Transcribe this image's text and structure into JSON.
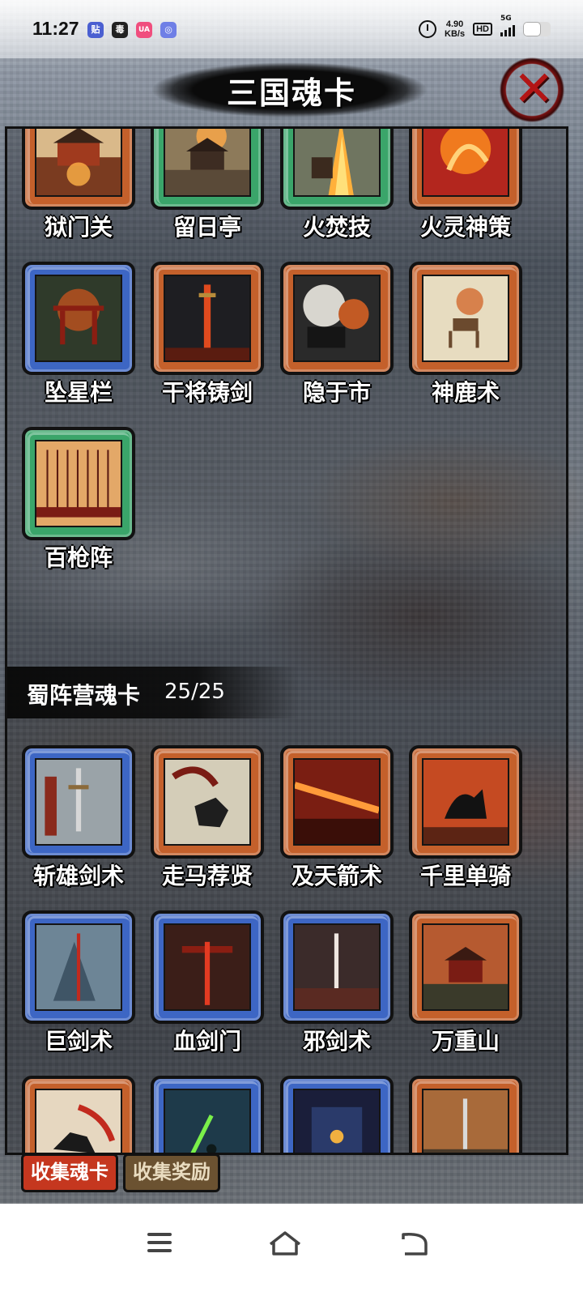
{
  "status_bar": {
    "time": "11:27",
    "app_icons": [
      "贴",
      "毒",
      "UA",
      "◎"
    ],
    "net_speed_value": "4.90",
    "net_speed_unit": "KB/s",
    "hd": "HD",
    "network": "5G",
    "battery_level": 0.65
  },
  "header": {
    "title": "三国魂卡",
    "close_icon": "close-icon"
  },
  "top_cards": [
    {
      "label": "狱门关",
      "rarity": "orange"
    },
    {
      "label": "留日亭",
      "rarity": "green"
    },
    {
      "label": "火焚技",
      "rarity": "green"
    },
    {
      "label": "火灵神策",
      "rarity": "orange"
    },
    {
      "label": "坠星栏",
      "rarity": "blue"
    },
    {
      "label": "干将铸剑",
      "rarity": "orange"
    },
    {
      "label": "隐于市",
      "rarity": "orange"
    },
    {
      "label": "神鹿术",
      "rarity": "orange"
    },
    {
      "label": "百枪阵",
      "rarity": "green"
    }
  ],
  "section": {
    "title": "蜀阵营魂卡",
    "count": "25/25"
  },
  "shu_cards": [
    {
      "label": "斩雄剑术",
      "rarity": "blue"
    },
    {
      "label": "走马荐贤",
      "rarity": "orange"
    },
    {
      "label": "及天箭术",
      "rarity": "orange"
    },
    {
      "label": "千里单骑",
      "rarity": "orange"
    },
    {
      "label": "巨剑术",
      "rarity": "blue"
    },
    {
      "label": "血剑门",
      "rarity": "blue"
    },
    {
      "label": "邪剑术",
      "rarity": "blue"
    },
    {
      "label": "万重山",
      "rarity": "orange"
    },
    {
      "label": "",
      "rarity": "orange"
    },
    {
      "label": "",
      "rarity": "blue"
    },
    {
      "label": "",
      "rarity": "blue"
    },
    {
      "label": "",
      "rarity": "orange"
    }
  ],
  "tabs": {
    "collect_cards": "收集魂卡",
    "collect_rewards": "收集奖励"
  },
  "nav": {
    "menu_icon": "menu-icon",
    "home_icon": "home-icon",
    "back_icon": "back-icon"
  }
}
